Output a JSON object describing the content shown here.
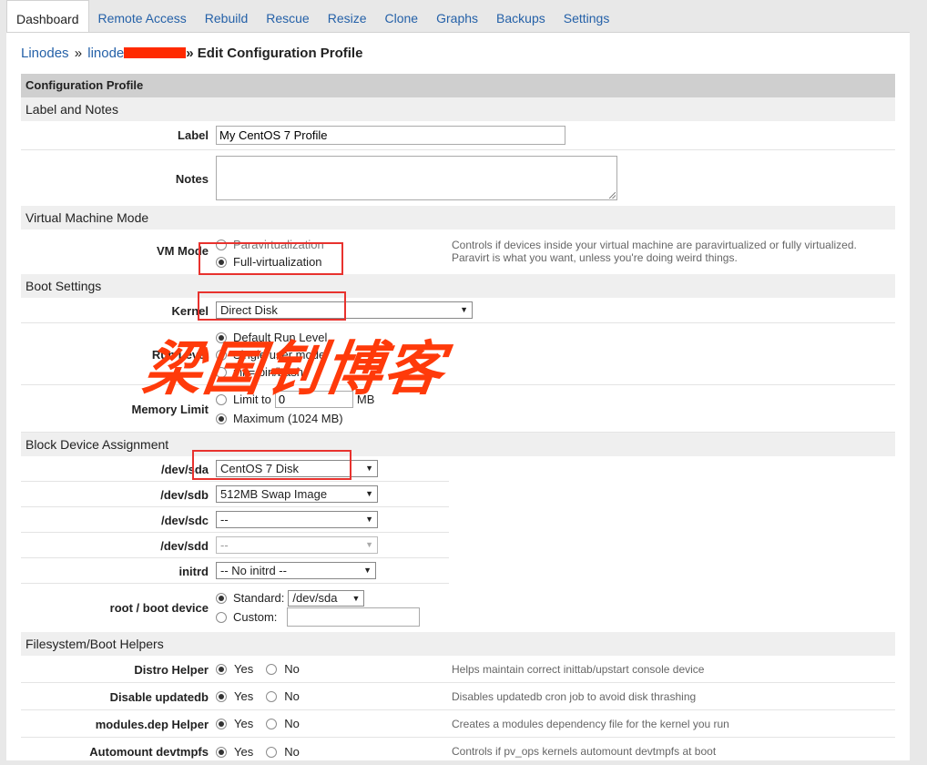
{
  "tabs": [
    {
      "label": "Dashboard",
      "active": true
    },
    {
      "label": "Remote Access"
    },
    {
      "label": "Rebuild"
    },
    {
      "label": "Rescue"
    },
    {
      "label": "Resize"
    },
    {
      "label": "Clone"
    },
    {
      "label": "Graphs"
    },
    {
      "label": "Backups"
    },
    {
      "label": "Settings"
    }
  ],
  "breadcrumb": {
    "root": "Linodes",
    "sep": "»",
    "node": "linode",
    "current": "» Edit Configuration Profile"
  },
  "header": "Configuration Profile",
  "sections": {
    "label_notes": "Label and Notes",
    "vm_mode": "Virtual Machine Mode",
    "boot": "Boot Settings",
    "block": "Block Device Assignment",
    "helpers": "Filesystem/Boot Helpers"
  },
  "fields": {
    "label": {
      "name": "Label",
      "value": "My CentOS 7 Profile"
    },
    "notes": {
      "name": "Notes",
      "value": ""
    },
    "vm_mode": {
      "name": "VM Mode",
      "options": [
        "Paravirtualization",
        "Full-virtualization"
      ],
      "selected": 1,
      "desc_line1": "Controls if devices inside your virtual machine are paravirtualized or fully virtualized.",
      "desc_line2": "Paravirt is what you want, unless you're doing weird things."
    },
    "kernel": {
      "name": "Kernel",
      "value": "Direct Disk"
    },
    "run_level": {
      "name": "Run Level",
      "options": [
        "Default Run Level",
        "Single user mode",
        "init=/bin/bash"
      ],
      "selected": 0
    },
    "memory_limit": {
      "name": "Memory Limit",
      "limit_label": "Limit to",
      "limit_value": "0",
      "limit_unit": "MB",
      "max_label": "Maximum (1024 MB)",
      "selected": "max"
    },
    "devices": [
      {
        "name": "/dev/sda",
        "value": "CentOS 7 Disk",
        "disabled": false
      },
      {
        "name": "/dev/sdb",
        "value": "512MB Swap Image",
        "disabled": false
      },
      {
        "name": "/dev/sdc",
        "value": "--",
        "disabled": false
      },
      {
        "name": "/dev/sdd",
        "value": "--",
        "disabled": true
      },
      {
        "name": "initrd",
        "value": "-- No initrd --",
        "disabled": false
      }
    ],
    "root_device": {
      "name": "root / boot device",
      "standard_label": "Standard:",
      "standard_value": "/dev/sda",
      "custom_label": "Custom:",
      "custom_value": "",
      "selected": "standard"
    }
  },
  "helpers": [
    {
      "name": "Distro Helper",
      "yes": "Yes",
      "no": "No",
      "value": "yes",
      "desc": "Helps maintain correct inittab/upstart console device"
    },
    {
      "name": "Disable updatedb",
      "yes": "Yes",
      "no": "No",
      "value": "yes",
      "desc": "Disables updatedb cron job to avoid disk thrashing"
    },
    {
      "name": "modules.dep Helper",
      "yes": "Yes",
      "no": "No",
      "value": "yes",
      "desc": "Creates a modules dependency file for the kernel you run"
    },
    {
      "name": "Automount devtmpfs",
      "yes": "Yes",
      "no": "No",
      "value": "yes",
      "desc": "Controls if pv_ops kernels automount devtmpfs at boot"
    }
  ],
  "watermark": "梁国钊博客",
  "colors": {
    "link": "#2561a8",
    "annotation": "#e8322e",
    "watermark": "#ff3a0a",
    "redaction": "#ff2a00"
  }
}
